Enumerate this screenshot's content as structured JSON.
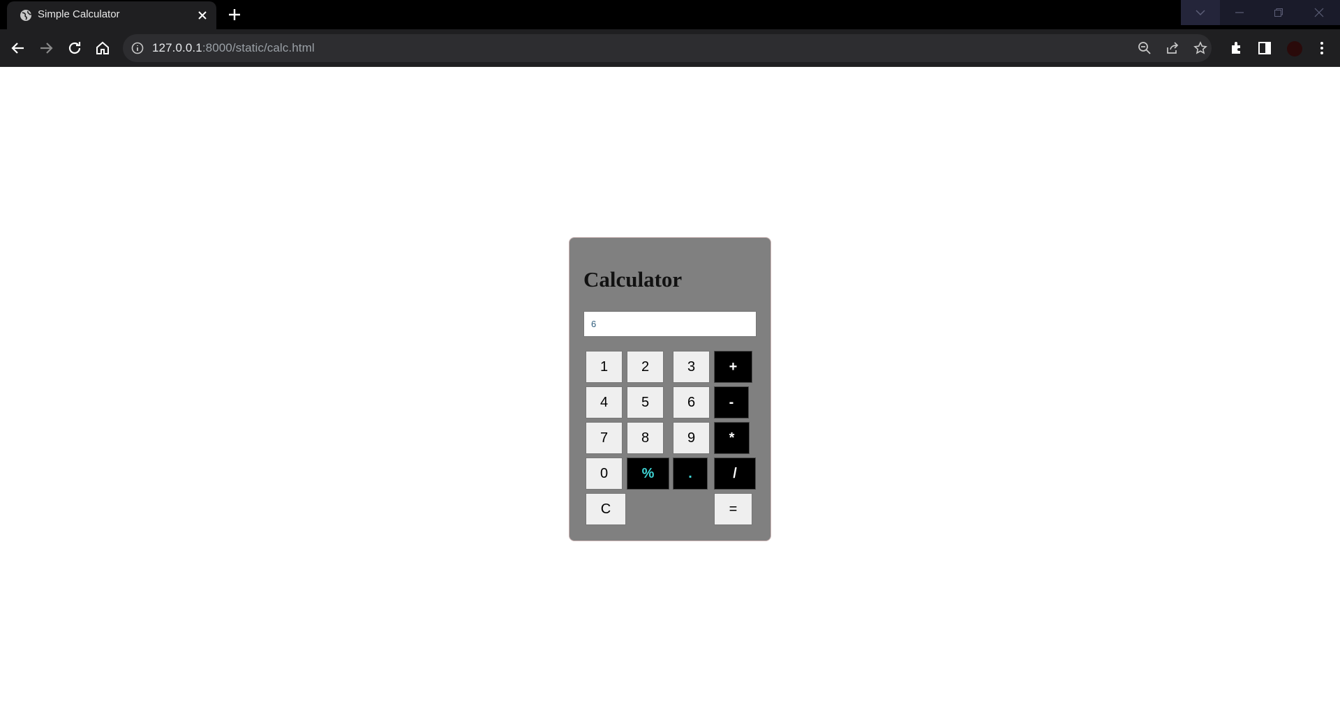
{
  "browser": {
    "tab_title": "Simple Calculator",
    "url_host": "127.0.0.1",
    "url_rest": ":8000/static/calc.html"
  },
  "calculator": {
    "title": "Calculator",
    "display_value": "6",
    "keys": {
      "k1": "1",
      "k2": "2",
      "k3": "3",
      "plus": "+",
      "k4": "4",
      "k5": "5",
      "k6": "6",
      "minus": "-",
      "k7": "7",
      "k8": "8",
      "k9": "9",
      "multiply": "*",
      "k0": "0",
      "percent": "%",
      "dot": ".",
      "divide": "/",
      "clear": "C",
      "equals": "="
    }
  },
  "colors": {
    "panel": "#808080",
    "operator_key": "#000000",
    "digit_key": "#efefef",
    "accent_text": "#3fd6d6"
  }
}
